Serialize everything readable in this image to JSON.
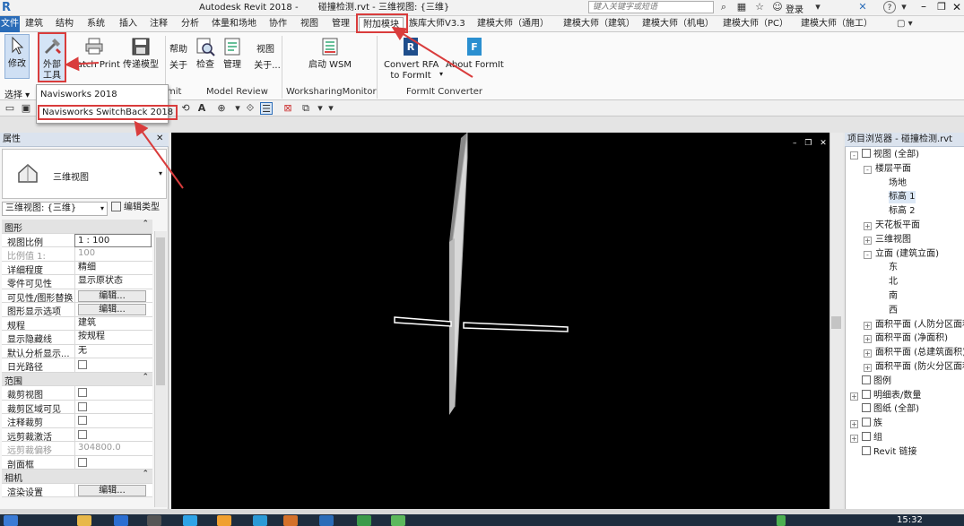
{
  "titlebar": {
    "app_title": "Autodesk Revit 2018 -",
    "doc_title": "碰撞检测.rvt - 三维视图: {三维}",
    "search_placeholder": "键入关键字或短语",
    "login_label": "登录",
    "help_label": "?"
  },
  "tabs": [
    "文件",
    "建筑",
    "结构",
    "系统",
    "插入",
    "注释",
    "分析",
    "体量和场地",
    "协作",
    "视图",
    "管理",
    "附加模块",
    "族库大师V3.3",
    "建模大师（通用）",
    "建模大师（建筑）",
    "建模大师（机电）",
    "建模大师（PC）",
    "建模大师（施工）"
  ],
  "ribbon": {
    "modify_label": "修改",
    "select_label": "选择",
    "external_tools_line1": "外部",
    "external_tools_line2": "工具",
    "batch_print_label": "Batch Print",
    "transmit_label": "传递模型",
    "help_label": "帮助",
    "about_label": "关于",
    "check_label": "检查",
    "manage_label": "管理",
    "view_label": "视图",
    "about2_label": "关于...",
    "launch_wsm_label": "启动 WSM",
    "convert_rfa_label": "Convert RFA",
    "to_formit_label": "to FormIt",
    "about_formit_label": "About FormIt",
    "panel_partial": "mit",
    "panel_model_review": "Model Review",
    "panel_wsm": "WorksharingMonitor",
    "panel_formit": "FormIt Converter"
  },
  "dropdown": {
    "item1": "Navisworks 2018",
    "item2": "Navisworks SwitchBack 2018"
  },
  "properties": {
    "title": "属性",
    "type_name": "三维视图",
    "view_selector": "三维视图: {三维}",
    "edit_type": "编辑类型",
    "rows": [
      {
        "label": "图形",
        "value": "",
        "kind": "section"
      },
      {
        "label": "视图比例",
        "value": "1 : 100",
        "kind": "input"
      },
      {
        "label": "比例值 1:",
        "value": "100",
        "kind": "grey"
      },
      {
        "label": "详细程度",
        "value": "精细",
        "kind": "text"
      },
      {
        "label": "零件可见性",
        "value": "显示原状态",
        "kind": "text"
      },
      {
        "label": "可见性/图形替换",
        "value": "编辑...",
        "kind": "button"
      },
      {
        "label": "图形显示选项",
        "value": "编辑...",
        "kind": "button"
      },
      {
        "label": "规程",
        "value": "建筑",
        "kind": "text"
      },
      {
        "label": "显示隐藏线",
        "value": "按规程",
        "kind": "text"
      },
      {
        "label": "默认分析显示...",
        "value": "无",
        "kind": "text"
      },
      {
        "label": "日光路径",
        "value": "",
        "kind": "check"
      },
      {
        "label": "范围",
        "value": "",
        "kind": "section"
      },
      {
        "label": "裁剪视图",
        "value": "",
        "kind": "check"
      },
      {
        "label": "裁剪区域可见",
        "value": "",
        "kind": "check"
      },
      {
        "label": "注释裁剪",
        "value": "",
        "kind": "check"
      },
      {
        "label": "远剪裁激活",
        "value": "",
        "kind": "check"
      },
      {
        "label": "远剪裁偏移",
        "value": "304800.0",
        "kind": "grey"
      },
      {
        "label": "剖面框",
        "value": "",
        "kind": "check"
      },
      {
        "label": "相机",
        "value": "",
        "kind": "section"
      },
      {
        "label": "渲染设置",
        "value": "编辑...",
        "kind": "button"
      }
    ]
  },
  "browser": {
    "title": "项目浏览器 - 碰撞检测.rvt",
    "nodes": [
      {
        "text": "视图 (全部)",
        "level": 0,
        "expander": "-"
      },
      {
        "text": "楼层平面",
        "level": 1,
        "expander": "-"
      },
      {
        "text": "场地",
        "level": 2,
        "expander": ""
      },
      {
        "text": "标高 1",
        "level": 2,
        "expander": ""
      },
      {
        "text": "标高 2",
        "level": 2,
        "expander": ""
      },
      {
        "text": "天花板平面",
        "level": 1,
        "expander": "+"
      },
      {
        "text": "三维视图",
        "level": 1,
        "expander": "+"
      },
      {
        "text": "立面 (建筑立面)",
        "level": 1,
        "expander": "-"
      },
      {
        "text": "东",
        "level": 2,
        "expander": ""
      },
      {
        "text": "北",
        "level": 2,
        "expander": ""
      },
      {
        "text": "南",
        "level": 2,
        "expander": ""
      },
      {
        "text": "西",
        "level": 2,
        "expander": ""
      },
      {
        "text": "面积平面 (人防分区面积)",
        "level": 1,
        "expander": "+"
      },
      {
        "text": "面积平面 (净面积)",
        "level": 1,
        "expander": "+"
      },
      {
        "text": "面积平面 (总建筑面积)",
        "level": 1,
        "expander": "+"
      },
      {
        "text": "面积平面 (防火分区面积)",
        "level": 1,
        "expander": "+"
      },
      {
        "text": "图例",
        "level": 0,
        "expander": ""
      },
      {
        "text": "明细表/数量",
        "level": 0,
        "expander": "+"
      },
      {
        "text": "图纸 (全部)",
        "level": 0,
        "expander": ""
      },
      {
        "text": "族",
        "level": 0,
        "expander": "+"
      },
      {
        "text": "组",
        "level": 0,
        "expander": "+"
      },
      {
        "text": "Revit 链接",
        "level": 0,
        "expander": ""
      }
    ]
  },
  "taskbar": {
    "clock": "15:32"
  },
  "colors": {
    "accent": "#2a6cb8",
    "annotation_red": "#d93c3c"
  }
}
